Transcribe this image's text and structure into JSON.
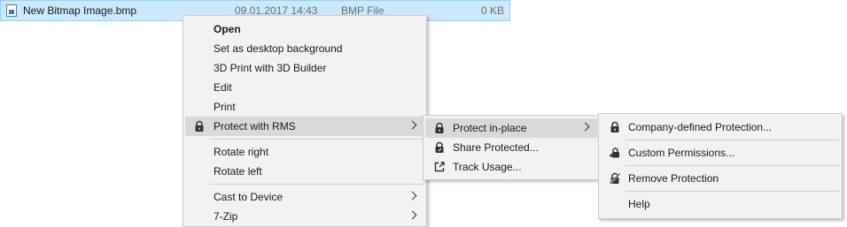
{
  "file": {
    "name": "New Bitmap Image.bmp",
    "date": "09.01.2017 14:43",
    "type": "BMP File",
    "size": "0 KB"
  },
  "context_menu": {
    "open": "Open",
    "set_desktop_bg": "Set as desktop background",
    "print_3d": "3D Print with 3D Builder",
    "edit": "Edit",
    "print": "Print",
    "protect_rms": "Protect with RMS",
    "rotate_right": "Rotate right",
    "rotate_left": "Rotate left",
    "cast_to_device": "Cast to Device",
    "seven_zip": "7-Zip"
  },
  "rms_submenu": {
    "protect_in_place": "Protect in-place",
    "share_protected": "Share Protected...",
    "track_usage": "Track Usage..."
  },
  "protection_submenu": {
    "company_defined": "Company-defined Protection...",
    "custom_permissions": "Custom Permissions...",
    "remove_protection": "Remove Protection",
    "help": "Help"
  },
  "icons": {
    "lock": "lock-icon",
    "share": "share-icon",
    "track": "external-link-icon",
    "custom": "lock-plus-icon",
    "remove": "lock-slash-icon"
  }
}
